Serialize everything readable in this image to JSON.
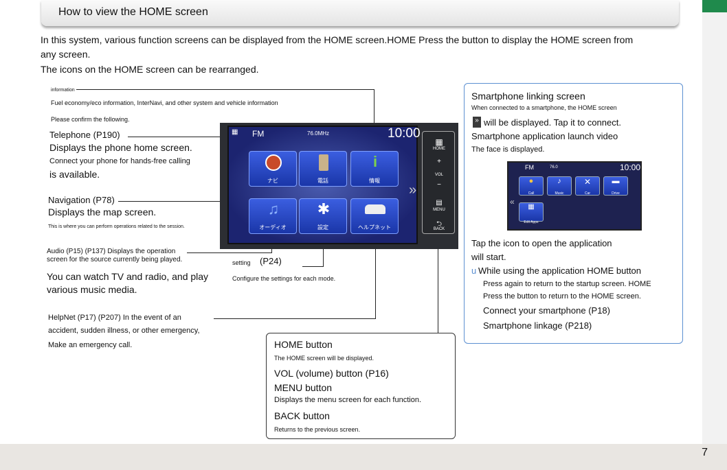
{
  "header": {
    "title": "How to view the HOME screen"
  },
  "intro": {
    "line1": "In this system, various function screens can be displayed from the HOME screen.HOME Press the button to display the HOME screen from",
    "line2": "any screen.",
    "line3": "The icons on the HOME screen can be rearranged."
  },
  "callouts": {
    "info_heading": "information",
    "info_desc": "Fuel economy/eco information, InterNavi, and other system and vehicle information",
    "info_confirm": "Please confirm the following.",
    "tel_title": "Telephone (P190)",
    "tel_desc1": "Displays the phone home screen.",
    "tel_desc2": "Connect your phone for hands-free calling",
    "tel_desc3": "is available.",
    "nav_title": "Navigation (P78)",
    "nav_desc1": "Displays the map screen.",
    "nav_desc2": "This is where you can perform operations related to the session.",
    "audio_line1": "Audio (P15) (P137) Displays the operation",
    "audio_line2": "screen for the source currently being played.",
    "audio_desc1": "You can watch TV and radio, and play",
    "audio_desc2": "various music media.",
    "setting_title": "setting",
    "setting_ref": "(P24)",
    "setting_desc": "Configure the settings for each mode.",
    "help_line1": "HelpNet (P17) (P207) In the event of an",
    "help_line2": "accident, sudden illness, or other emergency,",
    "help_line3": "Make an emergency call."
  },
  "buttons_box": {
    "home_title": "HOME button",
    "home_desc": "The HOME screen will be displayed.",
    "vol_title": "VOL (volume) button (P16)",
    "menu_title": "MENU button",
    "menu_desc": "Displays the menu screen for each function.",
    "back_title": "BACK button",
    "back_desc": "Returns to the previous screen."
  },
  "smartphone_box": {
    "title": "Smartphone linking screen",
    "line1": "When connected to a smartphone, the HOME screen",
    "line2": "will be displayed. Tap it to connect.",
    "line3": "Smartphone application launch video",
    "line4": "The face is displayed.",
    "line5": "Tap the icon to open the application",
    "line6": "will start.",
    "bullet": "u",
    "line7": "While using the application HOME button",
    "line8": "Press again to return to the startup screen. HOME",
    "line9": "Press the button to return to the HOME screen.",
    "line10": "Connect your smartphone (P18)",
    "line11": "Smartphone linkage (P218)"
  },
  "home_screen": {
    "band": "FM",
    "freq": "76.0MHz",
    "clock": "10:00",
    "tiles": [
      "ナビ",
      "電話",
      "情報",
      "オーディオ",
      "設定",
      "ヘルプネット"
    ],
    "side_buttons": [
      "HOME",
      "VOL",
      "MENU",
      "BACK"
    ]
  },
  "mini_screen": {
    "band": "FM",
    "freq": "76.0",
    "clock": "10:00",
    "tiles": [
      "Call",
      "Music",
      "Car",
      "Drive",
      "Edit Apps"
    ]
  },
  "page_number": "7",
  "colors": {
    "accent_green": "#1f8a4c",
    "blue_border": "#5b8fd1",
    "tile_blue": "#2a48c8"
  }
}
